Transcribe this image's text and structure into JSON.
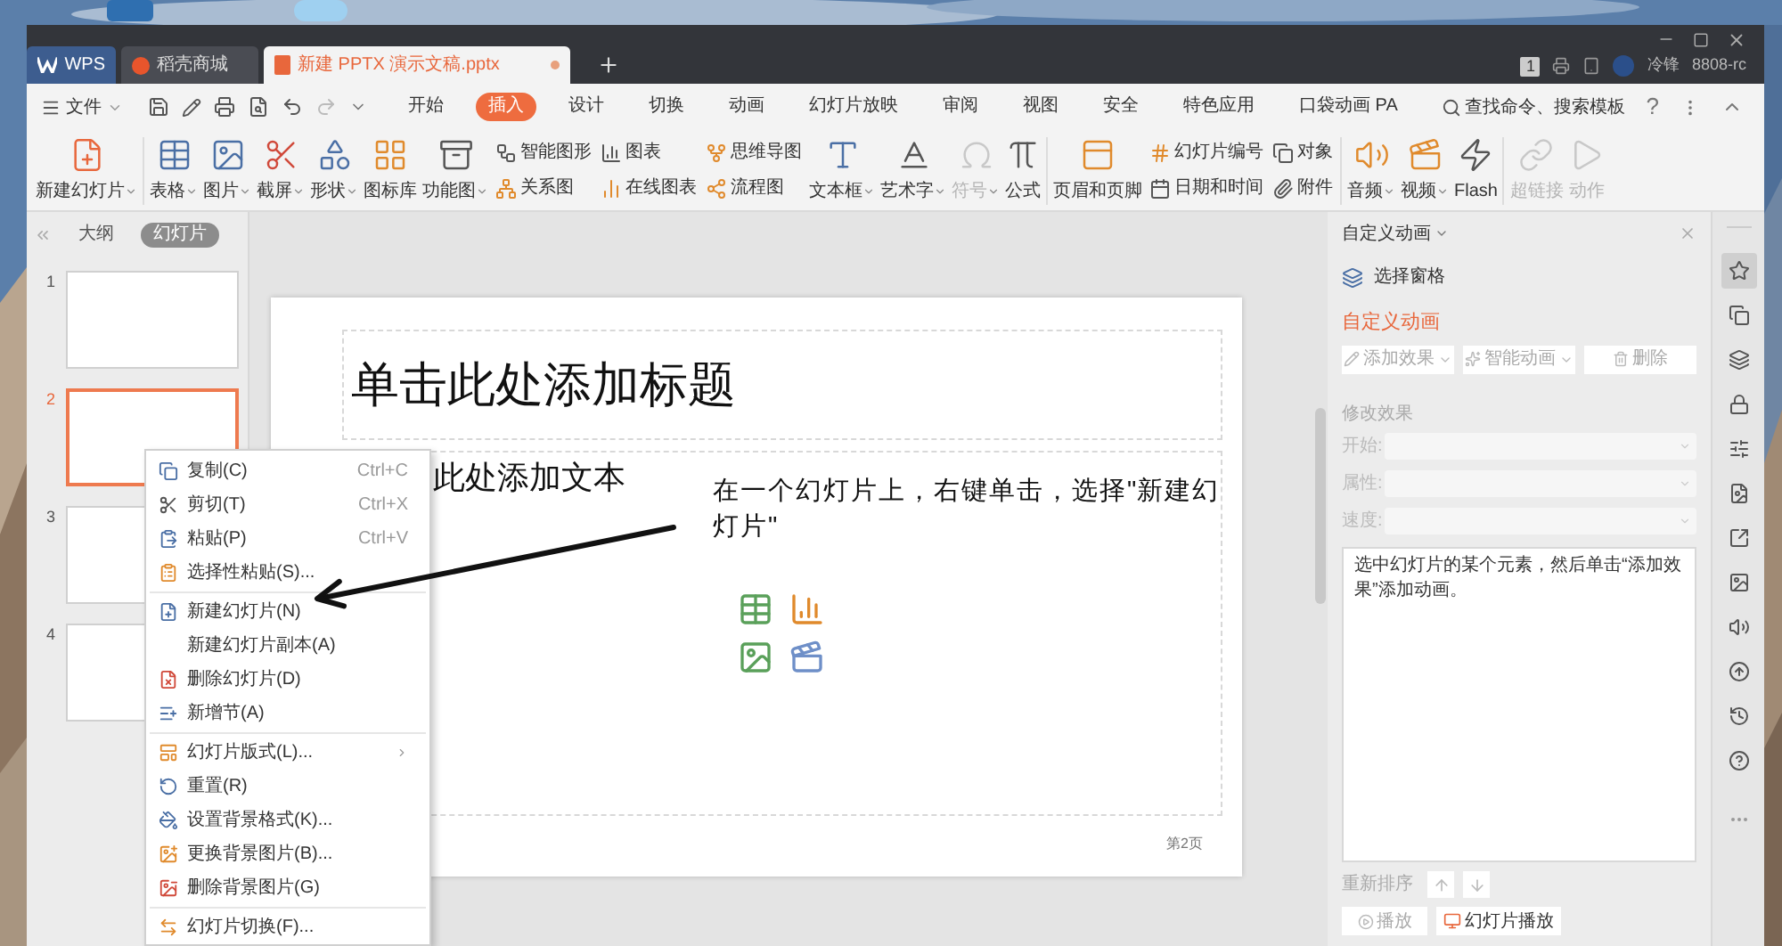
{
  "tabs": [
    {
      "label": "WPS",
      "selected": false
    },
    {
      "label": "稻壳商城",
      "selected": false
    },
    {
      "label": "新建 PPTX 演示文稿.pptx",
      "selected": true
    }
  ],
  "title_bar": {
    "badge": "1",
    "user": "冷锋",
    "account": "8808-rc"
  },
  "menu": {
    "file": "文件",
    "tabs": [
      {
        "label": "开始",
        "selected": false
      },
      {
        "label": "插入",
        "selected": true
      },
      {
        "label": "设计",
        "selected": false
      },
      {
        "label": "切换",
        "selected": false
      },
      {
        "label": "动画",
        "selected": false
      },
      {
        "label": "幻灯片放映",
        "selected": false
      },
      {
        "label": "审阅",
        "selected": false
      },
      {
        "label": "视图",
        "selected": false
      },
      {
        "label": "安全",
        "selected": false
      },
      {
        "label": "特色应用",
        "selected": false
      },
      {
        "label": "口袋动画 PA",
        "selected": false
      }
    ],
    "search": "查找命令、搜索模板",
    "help": "?"
  },
  "ribbon": {
    "groups": [
      {
        "items": [
          {
            "kind": "large",
            "label": "新建幻灯片",
            "dropdown": true,
            "disabled": false
          }
        ]
      },
      {
        "items": [
          {
            "kind": "large",
            "label": "表格",
            "dropdown": true,
            "disabled": false
          },
          {
            "kind": "large",
            "label": "图片",
            "dropdown": true,
            "disabled": false
          },
          {
            "kind": "large",
            "label": "截屏",
            "dropdown": true,
            "disabled": false
          },
          {
            "kind": "large",
            "label": "形状",
            "dropdown": true,
            "disabled": false
          },
          {
            "kind": "large",
            "label": "图标库",
            "dropdown": false,
            "disabled": false
          },
          {
            "kind": "large",
            "label": "功能图",
            "dropdown": true,
            "disabled": false
          },
          {
            "kind": "stack",
            "items": [
              {
                "label": "智能图形"
              },
              {
                "label": "关系图"
              }
            ]
          },
          {
            "kind": "stack",
            "items": [
              {
                "label": "图表"
              },
              {
                "label": "在线图表"
              }
            ]
          },
          {
            "kind": "stack",
            "items": [
              {
                "label": "思维导图"
              },
              {
                "label": "流程图"
              }
            ]
          },
          {
            "kind": "large",
            "label": "文本框",
            "dropdown": true,
            "disabled": false
          },
          {
            "kind": "large",
            "label": "艺术字",
            "dropdown": true,
            "disabled": false
          },
          {
            "kind": "large",
            "label": "符号",
            "dropdown": true,
            "disabled": true
          },
          {
            "kind": "large",
            "label": "公式",
            "dropdown": false,
            "disabled": false
          }
        ]
      },
      {
        "items": [
          {
            "kind": "large",
            "label": "页眉和页脚",
            "dropdown": false,
            "disabled": false
          },
          {
            "kind": "stack",
            "items": [
              {
                "label": "幻灯片编号"
              },
              {
                "label": "日期和时间"
              }
            ]
          },
          {
            "kind": "stack",
            "items": [
              {
                "label": "对象"
              },
              {
                "label": "附件"
              }
            ]
          }
        ]
      },
      {
        "items": [
          {
            "kind": "large",
            "label": "音频",
            "dropdown": true,
            "disabled": false
          },
          {
            "kind": "large",
            "label": "视频",
            "dropdown": true,
            "disabled": false
          },
          {
            "kind": "large",
            "label": "Flash",
            "dropdown": false,
            "disabled": false
          }
        ]
      },
      {
        "items": [
          {
            "kind": "large",
            "label": "超链接",
            "dropdown": false,
            "disabled": true
          },
          {
            "kind": "large",
            "label": "动作",
            "dropdown": false,
            "disabled": true
          }
        ]
      }
    ]
  },
  "slide_panel": {
    "tabs": [
      {
        "label": "大纲",
        "selected": false
      },
      {
        "label": "幻灯片",
        "selected": true
      }
    ],
    "thumbnails": [
      {
        "number": "1",
        "selected": false
      },
      {
        "number": "2",
        "selected": true
      },
      {
        "number": "3",
        "selected": false
      },
      {
        "number": "4",
        "selected": false
      }
    ]
  },
  "context_menu": [
    {
      "kind": "item",
      "label": "复制(C)",
      "shortcut": "Ctrl+C",
      "submenu": false
    },
    {
      "kind": "item",
      "label": "剪切(T)",
      "shortcut": "Ctrl+X",
      "submenu": false
    },
    {
      "kind": "item",
      "label": "粘贴(P)",
      "shortcut": "Ctrl+V",
      "submenu": false
    },
    {
      "kind": "item",
      "label": "选择性粘贴(S)...",
      "submenu": false
    },
    {
      "kind": "separator"
    },
    {
      "kind": "item",
      "label": "新建幻灯片(N)",
      "submenu": false
    },
    {
      "kind": "item",
      "label": "新建幻灯片副本(A)",
      "submenu": false
    },
    {
      "kind": "item",
      "label": "删除幻灯片(D)",
      "submenu": false
    },
    {
      "kind": "item",
      "label": "新增节(A)",
      "submenu": false
    },
    {
      "kind": "separator"
    },
    {
      "kind": "item",
      "label": "幻灯片版式(L)...",
      "submenu": true
    },
    {
      "kind": "item",
      "label": "重置(R)",
      "submenu": false
    },
    {
      "kind": "item",
      "label": "设置背景格式(K)...",
      "submenu": false
    },
    {
      "kind": "item",
      "label": "更换背景图片(B)...",
      "submenu": false
    },
    {
      "kind": "item",
      "label": "删除背景图片(G)",
      "submenu": false
    },
    {
      "kind": "separator"
    },
    {
      "kind": "item",
      "label": "幻灯片切换(F)...",
      "submenu": false
    }
  ],
  "slide": {
    "title_placeholder": "单击此处添加标题",
    "body_placeholder": "此处添加文本",
    "note": "在一个幻灯片上，右键单击，选择\"新建幻灯片\"",
    "page": "第2页"
  },
  "animation_pane": {
    "title": "自定义动画",
    "selection_pane": "选择窗格",
    "heading": "自定义动画",
    "buttons": [
      {
        "label": "添加效果",
        "dropdown": true,
        "disabled": true
      },
      {
        "label": "智能动画",
        "dropdown": true,
        "disabled": true
      },
      {
        "label": "删除",
        "dropdown": false,
        "disabled": true
      }
    ],
    "modify_label": "修改效果",
    "fields": [
      {
        "label": "开始:",
        "disabled": true
      },
      {
        "label": "属性:",
        "disabled": true
      },
      {
        "label": "速度:",
        "disabled": true
      }
    ],
    "hint": "选中幻灯片的某个元素，然后单击“添加效果”添加动画。",
    "reorder_label": "重新排序",
    "play": {
      "label": "播放",
      "disabled": true
    },
    "slideshow": "幻灯片播放"
  },
  "side_tools": [
    {
      "selected": true
    },
    {
      "selected": false
    },
    {
      "selected": false
    },
    {
      "selected": false
    },
    {
      "selected": false
    },
    {
      "selected": false
    },
    {
      "selected": false
    },
    {
      "selected": false
    },
    {
      "selected": false
    },
    {
      "selected": false
    },
    {
      "selected": false
    },
    {
      "selected": false
    }
  ]
}
